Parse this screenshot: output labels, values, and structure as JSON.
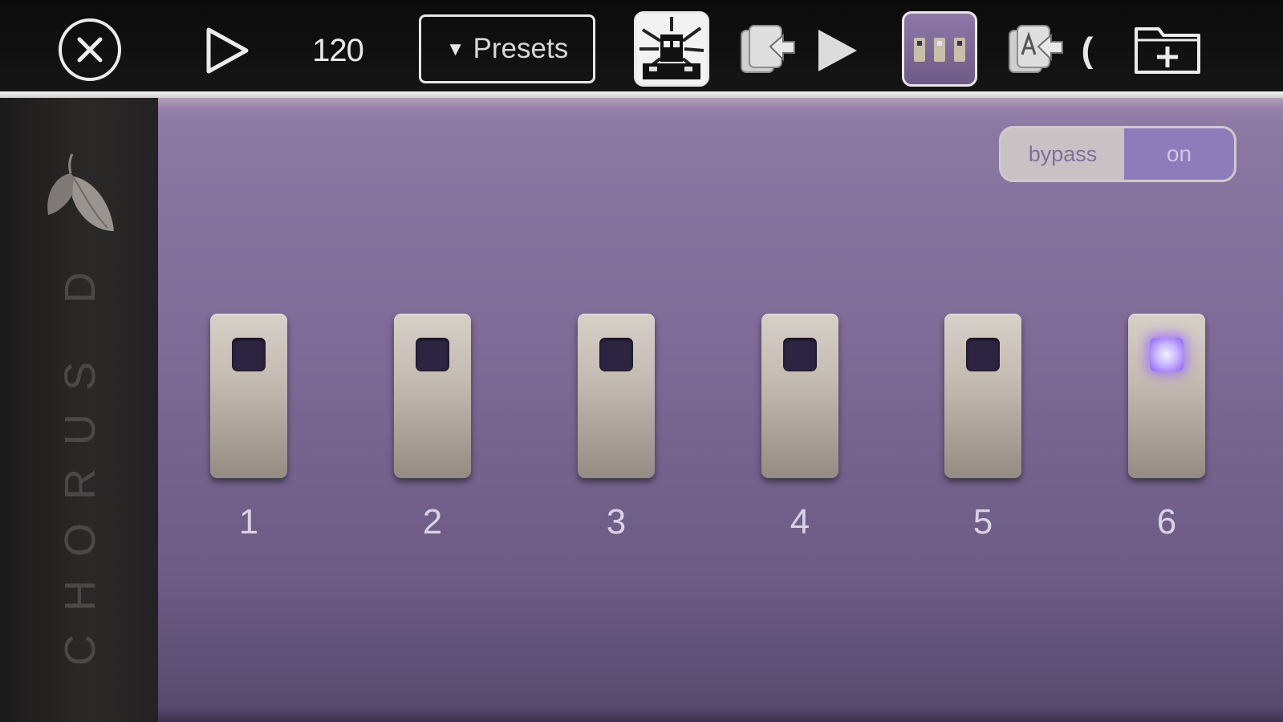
{
  "toolbar": {
    "tempo": "120",
    "presets_label": "Presets",
    "paren_glyph": "("
  },
  "side_panel": {
    "title": "CHORUS D"
  },
  "main": {
    "bypass_label": "bypass",
    "on_label": "on",
    "switches": [
      {
        "label": "1",
        "lit": false
      },
      {
        "label": "2",
        "lit": false
      },
      {
        "label": "3",
        "lit": false
      },
      {
        "label": "4",
        "lit": false
      },
      {
        "label": "5",
        "lit": false
      },
      {
        "label": "6",
        "lit": true
      }
    ]
  },
  "colors": {
    "panel_purple": "#7e6b97",
    "led_on": "#8b5cf6",
    "toggle_on": "#8e7cba"
  },
  "icons": [
    "close-icon",
    "play-outline-icon",
    "import-preset-icon",
    "play-solid-icon",
    "import-audio-icon",
    "new-folder-icon",
    "leaf-logo-icon"
  ]
}
